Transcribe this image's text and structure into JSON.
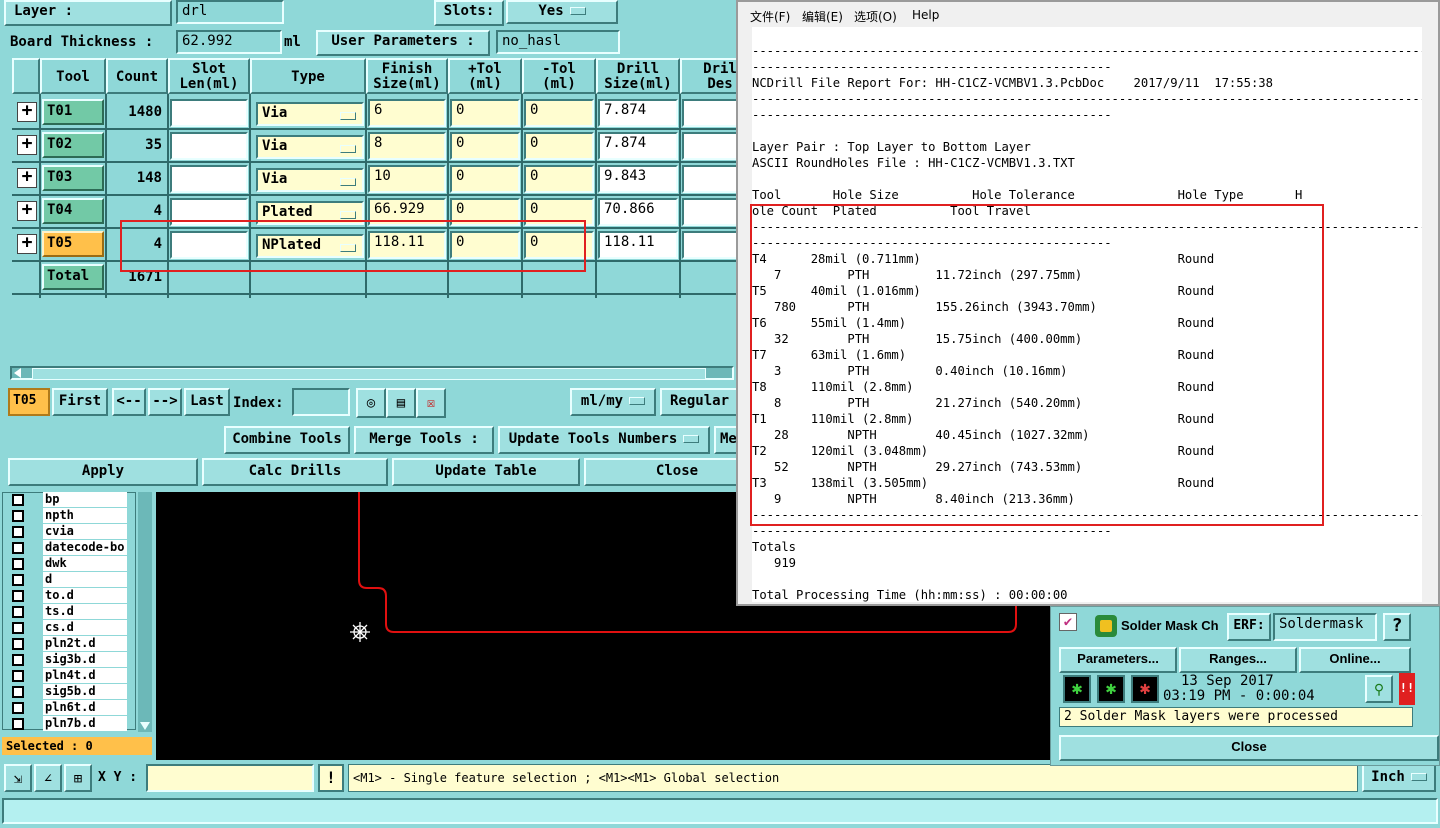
{
  "top_bar": {
    "layer_label": "Layer :",
    "layer_value": "drl",
    "slots_label": "Slots:",
    "slots_value": "Yes",
    "thickness_label": "Board Thickness :",
    "thickness_value": "62.992",
    "thickness_unit": "ml",
    "user_params_label": "User Parameters :",
    "user_params_value": "no_hasl"
  },
  "table": {
    "headers": [
      "Tool",
      "Count",
      "Slot\nLen(ml)",
      "Type",
      "Finish\nSize(ml)",
      "+Tol\n(ml)",
      "-Tol\n(ml)",
      "Drill\nSize(ml)",
      "Dril\nDes"
    ],
    "rows": [
      {
        "plus": "+",
        "tool": "T01",
        "count": "1480",
        "slot": "",
        "type": "Via",
        "finish": "6",
        "ptol": "0",
        "ntol": "0",
        "drill": "7.874"
      },
      {
        "plus": "+",
        "tool": "T02",
        "count": "35",
        "slot": "",
        "type": "Via",
        "finish": "8",
        "ptol": "0",
        "ntol": "0",
        "drill": "7.874"
      },
      {
        "plus": "+",
        "tool": "T03",
        "count": "148",
        "slot": "",
        "type": "Via",
        "finish": "10",
        "ptol": "0",
        "ntol": "0",
        "drill": "9.843"
      },
      {
        "plus": "+",
        "tool": "T04",
        "count": "4",
        "slot": "",
        "type": "Plated",
        "finish": "66.929",
        "ptol": "0",
        "ntol": "0",
        "drill": "70.866"
      },
      {
        "plus": "+",
        "tool": "T05",
        "count": "4",
        "slot": "",
        "type": "NPlated",
        "finish": "118.11",
        "ptol": "0",
        "ntol": "0",
        "drill": "118.11"
      }
    ],
    "total_label": "Total",
    "total_value": "1671"
  },
  "nav": {
    "current": "T05",
    "first": "First",
    "prev": "<--",
    "next": "-->",
    "last": "Last",
    "index_label": "Index:",
    "index_value": "",
    "units": "ml/my",
    "mode": "Regular"
  },
  "actions": {
    "combine": "Combine Tools",
    "merge": "Merge Tools :",
    "update_numbers": "Update Tools Numbers",
    "me": "Me",
    "apply": "Apply",
    "calc": "Calc Drills",
    "update_table": "Update Table",
    "close": "Close"
  },
  "layers": [
    "bp",
    "npth",
    "cvia",
    "datecode-bo",
    "dwk",
    "d",
    "to.d",
    "ts.d",
    "cs.d",
    "pln2t.d",
    "sig3b.d",
    "pln4t.d",
    "sig5b.d",
    "pln6t.d",
    "pln7b.d"
  ],
  "selected_text": "Selected : 0",
  "status": {
    "xy_label": "X Y :",
    "xy_value": "",
    "alert": "!",
    "message": "<M1> - Single feature selection ; <M1><M1> Global selection",
    "unit": "Inch"
  },
  "report": {
    "menu": [
      "文件(F)",
      "编辑(E)",
      "选项(O)",
      "Help"
    ],
    "lines": [
      "",
      "-----------------------------------------------------------------------------------------------",
      "-------------------------------------------------",
      "NCDrill File Report For: HH-C1CZ-VCMBV1.3.PcbDoc    2017/9/11  17:55:38",
      "-----------------------------------------------------------------------------------------------",
      "-------------------------------------------------",
      "",
      "Layer Pair : Top Layer to Bottom Layer",
      "ASCII RoundHoles File : HH-C1CZ-VCMBV1.3.TXT",
      "",
      "Tool       Hole Size          Hole Tolerance              Hole Type       H",
      "ole Count  Plated          Tool Travel",
      "-----------------------------------------------------------------------------------------------",
      "-------------------------------------------------",
      "T4      28mil (0.711mm)                                   Round",
      "   7         PTH         11.72inch (297.75mm)",
      "T5      40mil (1.016mm)                                   Round",
      "   780       PTH         155.26inch (3943.70mm)",
      "T6      55mil (1.4mm)                                     Round",
      "   32        PTH         15.75inch (400.00mm)",
      "T7      63mil (1.6mm)                                     Round",
      "   3         PTH         0.40inch (10.16mm)",
      "T8      110mil (2.8mm)                                    Round",
      "   8         PTH         21.27inch (540.20mm)",
      "T1      110mil (2.8mm)                                    Round",
      "   28        NPTH        40.45inch (1027.32mm)",
      "T2      120mil (3.048mm)                                  Round",
      "   52        NPTH        29.27inch (743.53mm)",
      "T3      138mil (3.505mm)                                  Round",
      "   9         NPTH        8.40inch (213.36mm)",
      "-----------------------------------------------------------------------------------------------",
      "-------------------------------------------------",
      "Totals",
      "   919",
      "",
      "Total Processing Time (hh:mm:ss) : 00:00:00"
    ]
  },
  "soldermask": {
    "title": "Solder Mask Ch",
    "erf_label": "ERF:",
    "erf_value": "Soldermask",
    "help": "?",
    "parameters": "Parameters...",
    "ranges": "Ranges...",
    "online": "Online...",
    "date": "13 Sep 2017",
    "time": "03:19 PM - 0:00:04",
    "alert": "!!",
    "message": "2 Solder Mask layers were processed",
    "close": "Close"
  },
  "colors": {
    "teal": "#8fd8d8",
    "tool_green": "#72c9a6",
    "highlight": "#ffc04a",
    "field_yellow": "#fffdd0",
    "annotation_red": "#e02020",
    "trace_red": "#e01010"
  }
}
